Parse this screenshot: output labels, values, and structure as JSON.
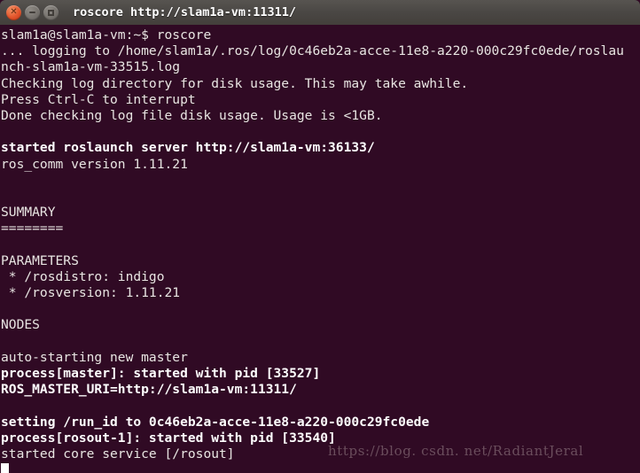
{
  "window": {
    "title": "roscore http://slam1a-vm:11311/",
    "buttons": [
      {
        "name": "close",
        "label": "×"
      },
      {
        "name": "minimize",
        "label": "–"
      },
      {
        "name": "maximize",
        "label": "□"
      }
    ],
    "background_color": "#300a24",
    "titlebar_color": "#4a4744",
    "close_button_color": "#e2522a"
  },
  "terminal": {
    "prompt": "slam1a@slam1a-vm:~$",
    "command": "roscore",
    "text_color": "#e8e5e2",
    "bold_color": "#ffffff",
    "cursor": "block",
    "lines": [
      {
        "text": "slam1a@slam1a-vm:~$ roscore",
        "bold": false
      },
      {
        "text": "... logging to /home/slam1a/.ros/log/0c46eb2a-acce-11e8-a220-000c29fc0ede/roslau",
        "bold": false
      },
      {
        "text": "nch-slam1a-vm-33515.log",
        "bold": false
      },
      {
        "text": "Checking log directory for disk usage. This may take awhile.",
        "bold": false
      },
      {
        "text": "Press Ctrl-C to interrupt",
        "bold": false
      },
      {
        "text": "Done checking log file disk usage. Usage is <1GB.",
        "bold": false
      },
      {
        "text": "",
        "bold": false
      },
      {
        "text": "started roslaunch server http://slam1a-vm:36133/",
        "bold": true
      },
      {
        "text": "ros_comm version 1.11.21",
        "bold": false
      },
      {
        "text": "",
        "bold": false
      },
      {
        "text": "",
        "bold": false
      },
      {
        "text": "SUMMARY",
        "bold": false
      },
      {
        "text": "========",
        "bold": false
      },
      {
        "text": "",
        "bold": false
      },
      {
        "text": "PARAMETERS",
        "bold": false
      },
      {
        "text": " * /rosdistro: indigo",
        "bold": false
      },
      {
        "text": " * /rosversion: 1.11.21",
        "bold": false
      },
      {
        "text": "",
        "bold": false
      },
      {
        "text": "NODES",
        "bold": false
      },
      {
        "text": "",
        "bold": false
      },
      {
        "text": "auto-starting new master",
        "bold": false
      },
      {
        "text": "process[master]: started with pid [33527]",
        "bold": true
      },
      {
        "text": "ROS_MASTER_URI=http://slam1a-vm:11311/",
        "bold": true
      },
      {
        "text": "",
        "bold": false
      },
      {
        "text": "setting /run_id to 0c46eb2a-acce-11e8-a220-000c29fc0ede",
        "bold": true
      },
      {
        "text": "process[rosout-1]: started with pid [33540]",
        "bold": true
      },
      {
        "text": "started core service [/rosout]",
        "bold": false
      }
    ]
  },
  "watermark": {
    "text": "https://blog. csdn. net/RadiantJeral",
    "color": "#6e5160"
  }
}
